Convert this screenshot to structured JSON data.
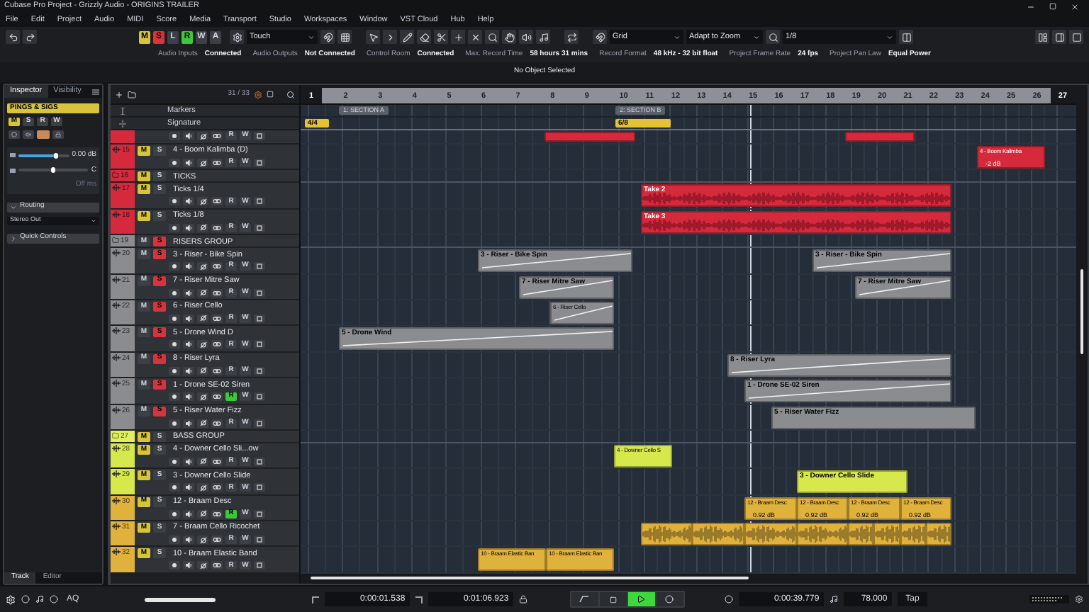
{
  "window": {
    "title": "Cubase Pro Project - Grizzly Audio - ORIGINS TRAILER"
  },
  "menu": [
    "File",
    "Edit",
    "Project",
    "Audio",
    "MIDI",
    "Score",
    "Media",
    "Transport",
    "Studio",
    "Workspaces",
    "Window",
    "VST Cloud",
    "Hub",
    "Help"
  ],
  "toolbar": {
    "state_buttons": [
      {
        "label": "M",
        "kind": "mute",
        "on": true
      },
      {
        "label": "S",
        "kind": "solo",
        "on": true
      },
      {
        "label": "L",
        "kind": "listen",
        "on": false
      },
      {
        "label": "R",
        "kind": "read",
        "on": true
      },
      {
        "label": "W",
        "kind": "write",
        "on": false
      },
      {
        "label": "A",
        "kind": "automation",
        "on": false
      }
    ],
    "automation_mode": "Touch",
    "snap_type": "Grid",
    "grid_type": "Adapt to Zoom",
    "quantize": "1/8"
  },
  "status": [
    {
      "label": "Audio Inputs",
      "value": "Connected"
    },
    {
      "label": "Audio Outputs",
      "value": "Not Connected"
    },
    {
      "label": "Control Room",
      "value": "Connected"
    },
    {
      "label": "Max. Record Time",
      "value": "58 hours 31 mins"
    },
    {
      "label": "Record Format",
      "value": "48 kHz - 32 bit float"
    },
    {
      "label": "Project Frame Rate",
      "value": "24 fps"
    },
    {
      "label": "Project Pan Law",
      "value": "Equal Power"
    }
  ],
  "info_line": "No Object Selected",
  "inspector": {
    "tabs": [
      {
        "label": "Inspector",
        "selected": true
      },
      {
        "label": "Visibility",
        "selected": false
      }
    ],
    "track_name": "PINGS & SIGS",
    "buttons": [
      {
        "label": "M",
        "kind": "mute",
        "on": true
      },
      {
        "label": "S",
        "kind": "solo",
        "on": false
      },
      {
        "label": "R",
        "kind": "read",
        "on": false
      },
      {
        "label": "W",
        "kind": "write",
        "on": false
      }
    ],
    "volume": {
      "level": 0.75,
      "reading": "0.00 dB"
    },
    "pan": {
      "level": 0.5,
      "reading": "C"
    },
    "delay": {
      "reading": "Off ms"
    },
    "sections": [
      {
        "title": "Routing",
        "expanded": true,
        "output": "Stereo Out"
      },
      {
        "title": "Quick Controls",
        "expanded": false
      }
    ],
    "bottom_tabs": [
      {
        "label": "Track",
        "selected": true
      },
      {
        "label": "Editor",
        "selected": false
      }
    ]
  },
  "track_list": {
    "count": "31 / 33",
    "ruler_tracks": [
      {
        "kind": "markers",
        "name": "Markers"
      },
      {
        "kind": "signature",
        "name": "Signature"
      }
    ],
    "tracks": [
      {
        "kind": "partial",
        "color": "#d42a3c",
        "read": {
          "label": "R",
          "on": false
        },
        "write": {
          "label": "W"
        },
        "clips": [
          {
            "selected": false
          },
          {
            "selected": false
          }
        ]
      },
      {
        "kind": "audio",
        "number": "15",
        "name": "4 - Boom Kalimba (D)",
        "color": "#d42a3c",
        "mute": {
          "label": "M",
          "on": true
        },
        "solo": {
          "label": "S",
          "on": false
        },
        "read": {
          "label": "R",
          "on": false
        },
        "write": {
          "label": "W"
        },
        "clips": [
          {
            "name": "4 - Boom Kalimba",
            "gain": "-2 dB",
            "selected": false
          }
        ]
      },
      {
        "kind": "group",
        "number": "16",
        "name": "TICKS",
        "color": "#d42a3c",
        "mute": {
          "label": "M",
          "on": true
        },
        "solo": {
          "label": "S",
          "on": false
        }
      },
      {
        "kind": "audio",
        "number": "17",
        "name": "Ticks 1/4",
        "color": "#d42a3c",
        "mute": {
          "label": "M",
          "on": true
        },
        "solo": {
          "label": "S",
          "on": false
        },
        "read": {
          "label": "R",
          "on": false
        },
        "write": {
          "label": "W"
        },
        "clips": [
          {
            "name": "Take 2",
            "selected": false
          }
        ]
      },
      {
        "kind": "audio",
        "number": "18",
        "name": "Ticks 1/8",
        "color": "#d42a3c",
        "mute": {
          "label": "M",
          "on": true
        },
        "solo": {
          "label": "S",
          "on": false
        },
        "read": {
          "label": "R",
          "on": false
        },
        "write": {
          "label": "W"
        },
        "clips": [
          {
            "name": "Take 3",
            "selected": false
          }
        ]
      },
      {
        "kind": "group",
        "number": "19",
        "name": "RISERS GROUP",
        "color": "#8a8c90",
        "mute": {
          "label": "M",
          "on": false
        },
        "solo": {
          "label": "S",
          "on": true
        }
      },
      {
        "kind": "audio",
        "number": "20",
        "name": "3 - Riser - Bike Spin",
        "color": "#8a8c90",
        "mute": {
          "label": "M",
          "on": false
        },
        "solo": {
          "label": "S",
          "on": true
        },
        "read": {
          "label": "R",
          "on": false
        },
        "write": {
          "label": "W"
        },
        "clips": [
          {
            "name": "3 - Riser - Bike Spin",
            "selected": false
          },
          {
            "name": "3 - Riser - Bike Spin",
            "selected": false
          }
        ]
      },
      {
        "kind": "audio",
        "number": "21",
        "name": "7 - Riser Mitre Saw",
        "color": "#8a8c90",
        "mute": {
          "label": "M",
          "on": false
        },
        "solo": {
          "label": "S",
          "on": true
        },
        "read": {
          "label": "R",
          "on": false
        },
        "write": {
          "label": "W"
        },
        "clips": [
          {
            "name": "7 - Riser Mitre Saw",
            "selected": false
          },
          {
            "name": "7 - Riser Mitre Saw",
            "selected": false
          }
        ]
      },
      {
        "kind": "audio",
        "number": "22",
        "name": "6 - Riser Cello",
        "color": "#8a8c90",
        "mute": {
          "label": "M",
          "on": false
        },
        "solo": {
          "label": "S",
          "on": true
        },
        "read": {
          "label": "R",
          "on": false
        },
        "write": {
          "label": "W"
        },
        "clips": [
          {
            "name": "6 - Riser Cello",
            "selected": false
          }
        ]
      },
      {
        "kind": "audio",
        "number": "23",
        "name": "5 - Drone Wind D",
        "color": "#8a8c90",
        "mute": {
          "label": "M",
          "on": false
        },
        "solo": {
          "label": "S",
          "on": true
        },
        "read": {
          "label": "R",
          "on": false
        },
        "write": {
          "label": "W"
        },
        "clips": [
          {
            "name": "5 - Drone Wind",
            "selected": false
          }
        ]
      },
      {
        "kind": "audio",
        "number": "24",
        "name": "8 - Riser Lyra",
        "color": "#8a8c90",
        "mute": {
          "label": "M",
          "on": false
        },
        "solo": {
          "label": "S",
          "on": true
        },
        "read": {
          "label": "R",
          "on": false
        },
        "write": {
          "label": "W"
        },
        "clips": [
          {
            "name": "8 - Riser Lyra",
            "selected": false
          }
        ]
      },
      {
        "kind": "audio",
        "number": "25",
        "name": "1 - Drone SE-02 Siren",
        "color": "#8a8c90",
        "mute": {
          "label": "M",
          "on": false
        },
        "solo": {
          "label": "S",
          "on": true
        },
        "read": {
          "label": "R",
          "on": true
        },
        "write": {
          "label": "W"
        },
        "clips": [
          {
            "name": "1 - Drone SE-02 Siren",
            "selected": false
          }
        ]
      },
      {
        "kind": "audio",
        "number": "26",
        "name": "5 - Riser Water Fizz",
        "color": "#8a8c90",
        "mute": {
          "label": "M",
          "on": false
        },
        "solo": {
          "label": "S",
          "on": true
        },
        "read": {
          "label": "R",
          "on": false
        },
        "write": {
          "label": "W"
        },
        "clips": [
          {
            "name": "5 - Riser Water Fizz",
            "selected": false
          }
        ]
      },
      {
        "kind": "group",
        "number": "27",
        "name": "BASS GROUP",
        "color": "#e2f060",
        "mute": {
          "label": "M",
          "on": true
        },
        "solo": {
          "label": "S",
          "on": false
        }
      },
      {
        "kind": "audio",
        "number": "28",
        "name": "4 - Downer Cello Sli...ow",
        "color": "#d6e84c",
        "mute": {
          "label": "M",
          "on": true
        },
        "solo": {
          "label": "S",
          "on": false
        },
        "read": {
          "label": "R",
          "on": false
        },
        "write": {
          "label": "W"
        },
        "clips": [
          {
            "name": "4 - Downer Cello S",
            "selected": false
          }
        ]
      },
      {
        "kind": "audio",
        "number": "29",
        "name": "3 - Downer Cello Slide",
        "color": "#d6e84c",
        "mute": {
          "label": "M",
          "on": true
        },
        "solo": {
          "label": "S",
          "on": false
        },
        "read": {
          "label": "R",
          "on": false
        },
        "write": {
          "label": "W"
        },
        "clips": [
          {
            "name": "3 - Downer Cello Slide",
            "selected": false
          }
        ]
      },
      {
        "kind": "audio",
        "number": "30",
        "name": "12 - Braam Desc",
        "color": "#e0b23c",
        "mute": {
          "label": "M",
          "on": true
        },
        "solo": {
          "label": "S",
          "on": false
        },
        "read": {
          "label": "R",
          "on": true
        },
        "write": {
          "label": "W"
        },
        "clips": [
          {
            "name": "12 - Braam Desc",
            "gain": "0.92 dB",
            "selected": false
          },
          {
            "name": "12 - Braam Desc",
            "gain": "0.92 dB",
            "selected": false
          },
          {
            "name": "12 - Braam Desc",
            "gain": "0.92 dB",
            "selected": false
          },
          {
            "name": "12 - Braam Desc",
            "gain": "0.92 dB",
            "selected": false
          }
        ]
      },
      {
        "kind": "audio",
        "number": "31",
        "name": "7 - Braam Cello Ricochet",
        "color": "#e0b23c",
        "mute": {
          "label": "M",
          "on": true
        },
        "solo": {
          "label": "S",
          "on": false
        },
        "read": {
          "label": "R",
          "on": false
        },
        "write": {
          "label": "W"
        },
        "clips": [
          {
            "selected": false
          },
          {
            "selected": false
          },
          {
            "selected": false
          },
          {
            "selected": false
          },
          {
            "selected": false
          },
          {
            "selected": false
          },
          {
            "selected": false
          },
          {
            "selected": false
          }
        ]
      },
      {
        "kind": "audio",
        "number": "32",
        "name": "10 - Braam Elastic Band",
        "color": "#e0b23c",
        "mute": {
          "label": "M",
          "on": true
        },
        "solo": {
          "label": "S",
          "on": false
        },
        "read": {
          "label": "R",
          "on": false
        },
        "write": {
          "label": "W"
        },
        "clips": [
          {
            "name": "10 - Braam Elastic Ban",
            "selected": false
          },
          {
            "name": "10 - Braam Elastic Ban",
            "selected": false
          }
        ]
      }
    ]
  },
  "ruler": {
    "bars": [
      "1",
      "2",
      "3",
      "4",
      "5",
      "6",
      "7",
      "8",
      "9",
      "10",
      "11",
      "12",
      "13",
      "14",
      "15",
      "16",
      "17",
      "18",
      "19",
      "20",
      "21",
      "22",
      "23",
      "24",
      "25",
      "26",
      "27"
    ]
  },
  "markers": [
    {
      "label": "1: SECTION A"
    },
    {
      "label": "2: SECTION B"
    }
  ],
  "signatures": [
    {
      "label": "4/4"
    },
    {
      "label": "6/8"
    }
  ],
  "transport": {
    "quantize_label": "AQ",
    "left_locator": "0:00:01.538",
    "right_locator": "0:01:06.923",
    "buttons": [
      {
        "kind": "cycle",
        "on": false
      },
      {
        "kind": "stop",
        "on": false
      },
      {
        "kind": "play",
        "on": true
      },
      {
        "kind": "record",
        "on": false
      }
    ],
    "position": "0:00:39.779",
    "tempo": "78.000",
    "tap": "Tap"
  }
}
